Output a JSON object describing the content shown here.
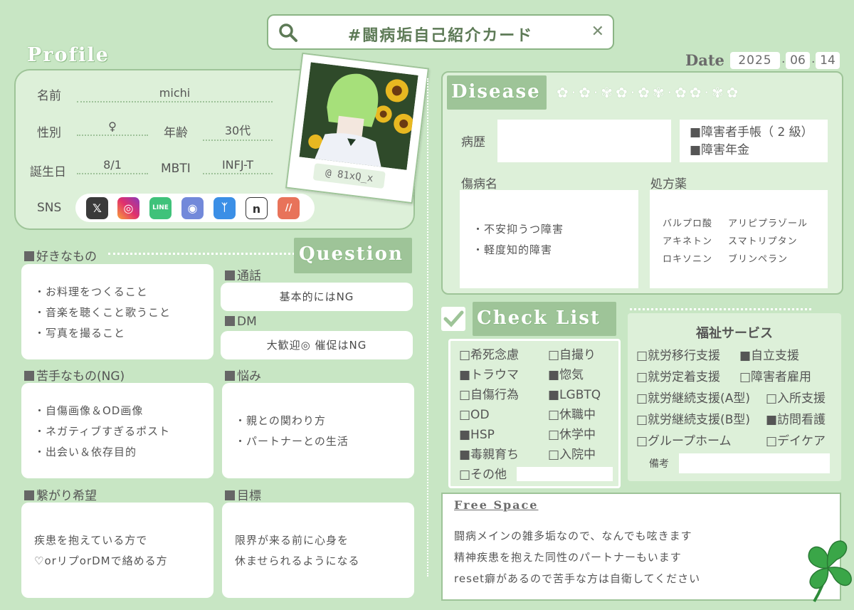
{
  "header": {
    "title": "#闘病垢自己紹介カード"
  },
  "date": {
    "label": "Date",
    "year": "2025",
    "month": "06",
    "day": "14",
    "sep": "."
  },
  "profile": {
    "heading": "Profile",
    "name_label": "名前",
    "name": "michi",
    "gender_label": "性別",
    "gender": "♀",
    "age_label": "年齢",
    "age": "30代",
    "birthday_label": "誕生日",
    "birthday": "8/1",
    "mbti_label": "MBTI",
    "mbti": "INFJ-T",
    "sns_label": "SNS",
    "sns": [
      {
        "name": "x",
        "glyph": "X",
        "color": "#3a3a3a"
      },
      {
        "name": "instagram",
        "glyph": "◎",
        "color": "#e1306c"
      },
      {
        "name": "line",
        "glyph": "LINE",
        "color": "#3fc27a"
      },
      {
        "name": "discord",
        "glyph": "◉",
        "color": "#7289da"
      },
      {
        "name": "bluesky",
        "glyph": "🦋",
        "color": "#3b8fe6"
      },
      {
        "name": "note",
        "glyph": "n",
        "color": "#ffffff"
      },
      {
        "name": "misskey",
        "glyph": "//",
        "color": "#e8735a"
      }
    ],
    "photo_handle": "@ 81xQ_x"
  },
  "question": {
    "heading": "Question",
    "likes": {
      "label": "好きなもの",
      "items": [
        "・お料理をつくること",
        "・音楽を聴くこと歌うこと",
        "・写真を撮ること"
      ]
    },
    "dislikes": {
      "label": "苦手なもの(NG)",
      "items": [
        "・自傷画像＆OD画像",
        "・ネガティブすぎるポスト",
        "・出会い＆依存目的"
      ]
    },
    "connect": {
      "label": "繋がり希望",
      "items": [
        "疾患を抱えている方で",
        "♡orリプorDMで絡める方"
      ]
    },
    "call": {
      "label": "通話",
      "value": "基本的にはNG"
    },
    "dm": {
      "label": "DM",
      "value": "大歓迎◎ 催促はNG"
    },
    "worries": {
      "label": "悩み",
      "items": [
        "・親との関わり方",
        "・パートナーとの生活"
      ]
    },
    "goal": {
      "label": "目標",
      "items": [
        "限界が来る前に心身を",
        "休ませられるようになる"
      ]
    }
  },
  "disease": {
    "heading": "Disease",
    "history_label": "病歴",
    "history": "",
    "certificates": [
      "■障害者手帳（ 2 級）",
      "■障害年金"
    ],
    "diagnosis_label": "傷病名",
    "diagnosis": [
      "・不安抑うつ障害",
      "・軽度知的障害"
    ],
    "meds_label": "処方薬",
    "meds": [
      [
        "バルプロ酸",
        "アリピプラゾール"
      ],
      [
        "アキネトン",
        "スマトリプタン"
      ],
      [
        "ロキソニン",
        "ブリンペラン"
      ]
    ]
  },
  "checklist": {
    "heading": "Check List",
    "left": [
      "□希死念慮",
      "■トラウマ",
      "□自傷行為",
      "□OD",
      "■HSP",
      "■毒親育ち",
      "□その他"
    ],
    "right": [
      "□自撮り",
      "■惚気",
      "■LGBTQ",
      "□休職中",
      "□休学中",
      "□入院中"
    ]
  },
  "welfare": {
    "title": "福祉サービス",
    "rows": [
      [
        "□就労移行支援",
        "■自立支援"
      ],
      [
        "□就労定着支援",
        "□障害者雇用"
      ],
      [
        "□就労継続支援(A型)",
        "□入所支援"
      ],
      [
        "□就労継続支援(B型)",
        "■訪問看護"
      ],
      [
        "□グループホーム",
        "□デイケア"
      ]
    ],
    "note_label": "備考"
  },
  "free": {
    "heading": "Free Space",
    "lines": [
      "闘病メインの雑多垢なので、なんでも呟きます",
      "精神疾患を抱えた同性のパートナーもいます",
      "reset癖があるので苦手な方は自衛してください"
    ]
  },
  "colors": {
    "bg": "#c8e6c4",
    "panel": "#ddf0d9",
    "accent": "#9ec498",
    "text": "#4a4a4a"
  }
}
